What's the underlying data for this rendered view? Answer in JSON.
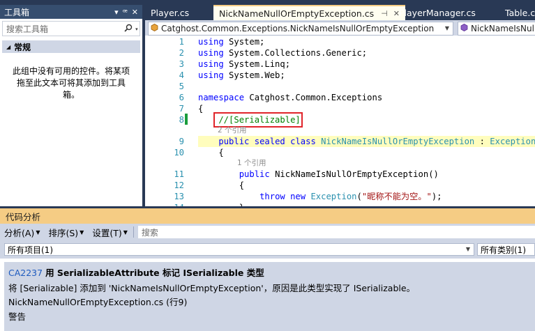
{
  "toolbox": {
    "title": "工具箱",
    "title_buttons": [
      "▾",
      "ꟹ",
      "✕"
    ],
    "search_placeholder": "搜索工具箱",
    "group_label": "常规",
    "empty_message": "此组中没有可用的控件。将某项拖至此文本可将其添加到工具箱。"
  },
  "tabs": [
    {
      "label": "Player.cs",
      "active": false
    },
    {
      "label": "NickNameNullOrEmptyException.cs",
      "active": true
    },
    {
      "label": "PlayerManager.cs",
      "active": false
    },
    {
      "label": "Table.cs",
      "active": false
    }
  ],
  "tab_pin_glyph": "⊣",
  "tab_close_glyph": "✕",
  "navbar": {
    "namespace": "Catghost.Common.Exceptions.NickNameIsNullOrEmptyException",
    "member": "NickNameIsNullOrEmptyException"
  },
  "code": {
    "lines": [
      {
        "n": "1",
        "parts": [
          {
            "t": "using",
            "c": "kw"
          },
          {
            "t": " System;",
            "c": ""
          }
        ]
      },
      {
        "n": "2",
        "parts": [
          {
            "t": "using",
            "c": "kw"
          },
          {
            "t": " System.Collections.Generic;",
            "c": ""
          }
        ]
      },
      {
        "n": "3",
        "parts": [
          {
            "t": "using",
            "c": "kw"
          },
          {
            "t": " System.Linq;",
            "c": ""
          }
        ]
      },
      {
        "n": "4",
        "parts": [
          {
            "t": "using",
            "c": "kw"
          },
          {
            "t": " System.Web;",
            "c": ""
          }
        ]
      },
      {
        "n": "5",
        "parts": []
      },
      {
        "n": "6",
        "parts": [
          {
            "t": "namespace",
            "c": "kw"
          },
          {
            "t": " Catghost.Common.Exceptions",
            "c": ""
          }
        ]
      },
      {
        "n": "7",
        "parts": [
          {
            "t": "{",
            "c": ""
          }
        ]
      },
      {
        "n": "8",
        "parts": [
          {
            "t": "    //[Serializable]",
            "c": "cm"
          }
        ]
      },
      {
        "n": "9",
        "parts": [
          {
            "t": "    ",
            "c": ""
          },
          {
            "t": "public",
            "c": "kw"
          },
          {
            "t": " ",
            "c": ""
          },
          {
            "t": "sealed",
            "c": "kw"
          },
          {
            "t": " ",
            "c": ""
          },
          {
            "t": "class",
            "c": "kw"
          },
          {
            "t": " NickNameIsNullOrEmptyException",
            "c": "ty"
          },
          {
            "t": " : ",
            "c": ""
          },
          {
            "t": "Exception",
            "c": "ty"
          }
        ]
      },
      {
        "n": "10",
        "parts": [
          {
            "t": "    {",
            "c": ""
          }
        ]
      },
      {
        "n": "11",
        "parts": [
          {
            "t": "        ",
            "c": ""
          },
          {
            "t": "public",
            "c": "kw"
          },
          {
            "t": " NickNameIsNullOrEmptyException()",
            "c": ""
          }
        ]
      },
      {
        "n": "12",
        "parts": [
          {
            "t": "        {",
            "c": ""
          }
        ]
      },
      {
        "n": "13",
        "parts": [
          {
            "t": "            ",
            "c": ""
          },
          {
            "t": "throw",
            "c": "kw"
          },
          {
            "t": " ",
            "c": ""
          },
          {
            "t": "new",
            "c": "kw"
          },
          {
            "t": " ",
            "c": ""
          },
          {
            "t": "Exception",
            "c": "ty"
          },
          {
            "t": "(",
            "c": ""
          },
          {
            "t": "\"昵称不能为空。\"",
            "c": "st"
          },
          {
            "t": ");",
            "c": ""
          }
        ]
      },
      {
        "n": "14",
        "parts": [
          {
            "t": "        }",
            "c": ""
          }
        ]
      }
    ],
    "codelens_class": "2 个引用",
    "codelens_ctor": "1 个引用"
  },
  "analysis": {
    "title": "代码分析",
    "toolbar": {
      "analyze": "分析(A)",
      "sort": "排序(S)",
      "settings": "设置(T)",
      "search_placeholder": "搜索"
    },
    "filter_items": "所有项目(1)",
    "filter_categories": "所有类别(1)",
    "result": {
      "code": "CA2237",
      "title": "用 SerializableAttribute 标记 ISerializable 类型",
      "description": "将 [Serializable] 添加到 'NickNameIsNullOrEmptyException'，原因是此类型实现了 ISerializable。",
      "location": "NickNameNullOrEmptyException.cs (行9)",
      "severity": "警告"
    }
  },
  "colors": {
    "chrome": "#293955",
    "tab_accent": "#f5cc84",
    "keyword": "#0000ff",
    "type": "#2b91af",
    "comment": "#008000",
    "string": "#a31515",
    "highlight": "#fffdbd",
    "error_box": "#e0242a"
  }
}
